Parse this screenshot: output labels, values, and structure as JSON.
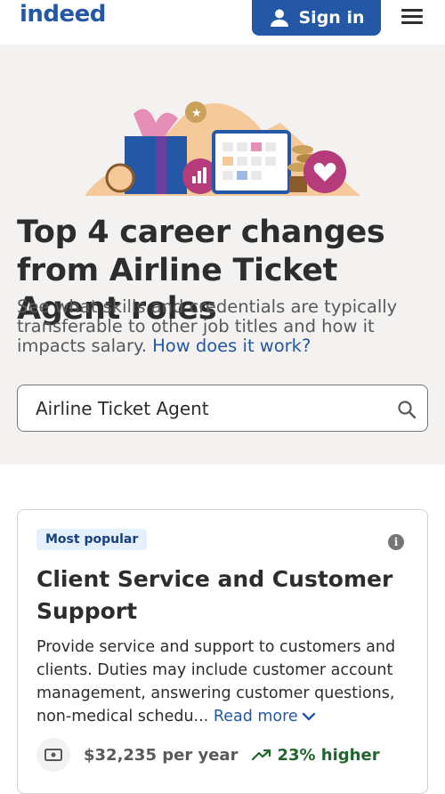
{
  "header": {
    "logo": "indeed",
    "sign_in_label": "Sign in",
    "brand_color": "#2557a7"
  },
  "hero": {
    "title": "Top 4 career changes from Airline Ticket Agent roles",
    "description": "See what skills and credentials are typically transferable to other job titles and how it impacts salary.",
    "how_link": "How does it work?",
    "search_value": "Airline Ticket Agent"
  },
  "card": {
    "badge": "Most popular",
    "title": "Client Service and Customer Support",
    "description": "Provide service and support to customers and clients. Duties may include customer account management, answering customer questions, non-medical schedu...",
    "read_more": "Read more",
    "salary": "$32,235 per year",
    "change": "23% higher"
  },
  "icons": [
    "person-icon",
    "menu-icon",
    "search-icon",
    "info-icon",
    "chevron-down-icon",
    "money-icon",
    "trend-up-icon"
  ]
}
